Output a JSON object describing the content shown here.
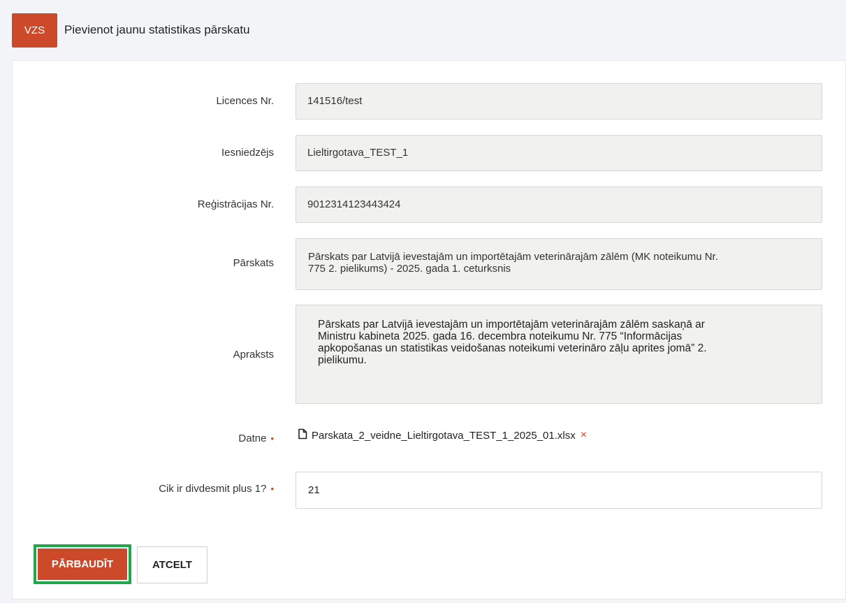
{
  "header": {
    "logo_text": "VZS",
    "title": "Pievienot jaunu statistikas pārskatu"
  },
  "form": {
    "license": {
      "label": "Licences Nr.",
      "value": "141516/test"
    },
    "submitter": {
      "label": "Iesniedzējs",
      "value": "Lieltirgotava_TEST_1"
    },
    "registration": {
      "label": "Reģistrācijas Nr.",
      "value": "9012314123443424"
    },
    "report": {
      "label": "Pārskats",
      "line1": "Pārskats par Latvijā ievestajām un importētajām veterinārajām zālēm (MK noteikumu Nr.",
      "line2": "775 2. pielikums) - 2025. gada 1. ceturksnis"
    },
    "description": {
      "label": "Apraksts",
      "line1": "Pārskats par Latvijā ievestajām un importētajām veterinārajām zālēm saskaņā ar",
      "line2": "Ministru kabineta 2025. gada 16. decembra noteikumu Nr. 775 “Informācijas",
      "line3": "apkopošanas un statistikas veidošanas noteikumi veterināro zāļu aprites jomā” 2.",
      "line4": "pielikumu."
    },
    "file": {
      "label": "Datne",
      "required_mark": "•",
      "filename": "Parskata_2_veidne_Lieltirgotava_TEST_1_2025_01.xlsx",
      "remove_symbol": "×"
    },
    "captcha": {
      "label": "Cik ir divdesmit plus 1?",
      "required_mark": "•",
      "value": "21"
    }
  },
  "actions": {
    "check_label": "PĀRBAUDĪT",
    "cancel_label": "ATCELT"
  },
  "colors": {
    "brand": "#cc4a2a",
    "highlight": "#1fa84a",
    "readonly_bg": "#f1f1ef"
  }
}
